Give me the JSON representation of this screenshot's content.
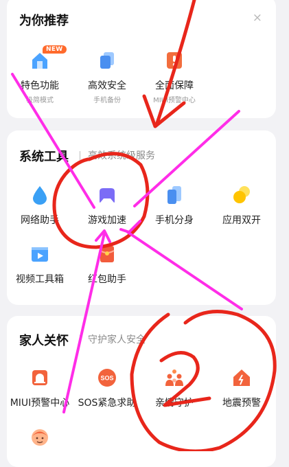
{
  "recommend": {
    "title": "为你推荐",
    "close_symbol": "×",
    "items": [
      {
        "label": "特色功能",
        "sub": "极简模式",
        "icon": "home-icon",
        "badge": "NEW"
      },
      {
        "label": "高效安全",
        "sub": "手机备份",
        "icon": "copy-icon"
      },
      {
        "label": "全面保障",
        "sub": "MIUI预警中心",
        "icon": "alert-doc-icon"
      }
    ]
  },
  "tools": {
    "title": "系统工具",
    "subtitle": "高效系统级服务",
    "items": [
      {
        "label": "网络助手",
        "icon": "droplet-icon"
      },
      {
        "label": "游戏加速",
        "icon": "gamepad-icon"
      },
      {
        "label": "手机分身",
        "icon": "dual-phone-icon"
      },
      {
        "label": "应用双开",
        "icon": "dual-circle-icon"
      },
      {
        "label": "视频工具箱",
        "icon": "video-icon"
      },
      {
        "label": "红包助手",
        "icon": "red-packet-icon"
      }
    ]
  },
  "family": {
    "title": "家人关怀",
    "subtitle": "守护家人安全",
    "items": [
      {
        "label": "MIUI预警中心",
        "icon": "siren-icon"
      },
      {
        "label": "SOS紧急求助",
        "icon": "sos-icon",
        "glyph": "SOS"
      },
      {
        "label": "亲情守护",
        "icon": "family-icon"
      },
      {
        "label": "地震预警",
        "icon": "earthquake-house-icon"
      },
      {
        "label": "",
        "icon": "child-face-icon"
      }
    ]
  },
  "colors": {
    "accent_orange": "#ff6a2c",
    "accent_blue": "#4ba3ff",
    "accent_purple": "#7b6cf6",
    "annotation_red": "#e8261b",
    "annotation_magenta": "#ff2de8"
  }
}
